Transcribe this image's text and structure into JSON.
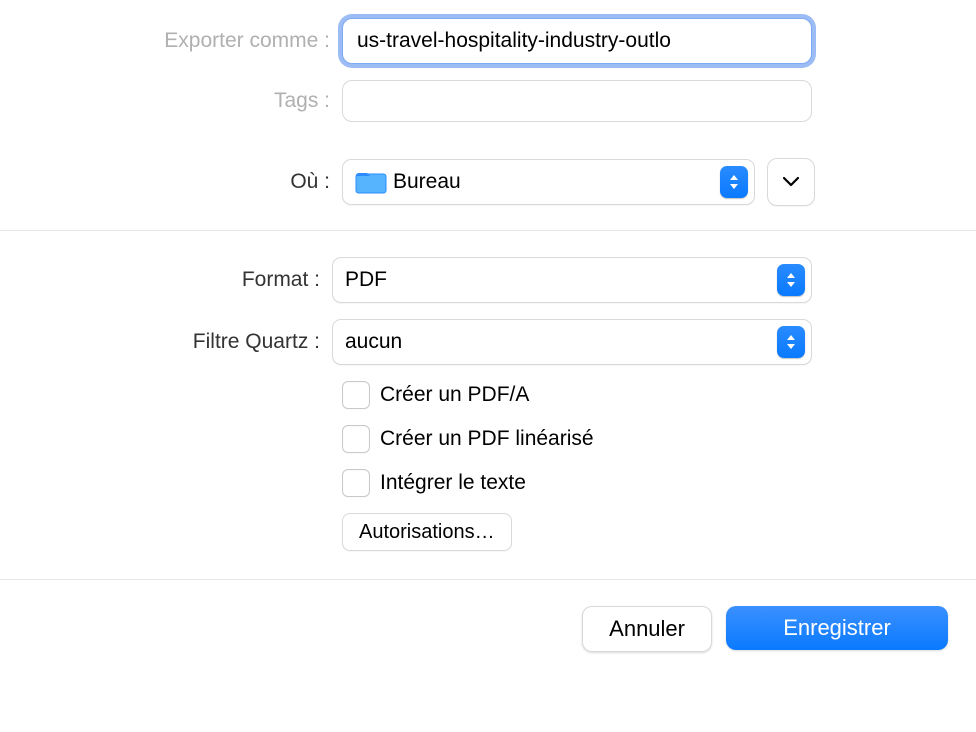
{
  "top": {
    "export_as_label": "Exporter comme :",
    "export_as_value": "us-travel-hospitality-industry-outlo",
    "tags_label": "Tags :",
    "tags_value": "",
    "where_label": "Où :",
    "where_value": "Bureau"
  },
  "middle": {
    "format_label": "Format :",
    "format_value": "PDF",
    "quartz_label": "Filtre Quartz :",
    "quartz_value": "aucun",
    "create_pdfa": "Créer un PDF/A",
    "create_linear": "Créer un PDF linéarisé",
    "embed_text": "Intégrer le texte",
    "permissions": "Autorisations…"
  },
  "bottom": {
    "cancel": "Annuler",
    "save": "Enregistrer"
  }
}
